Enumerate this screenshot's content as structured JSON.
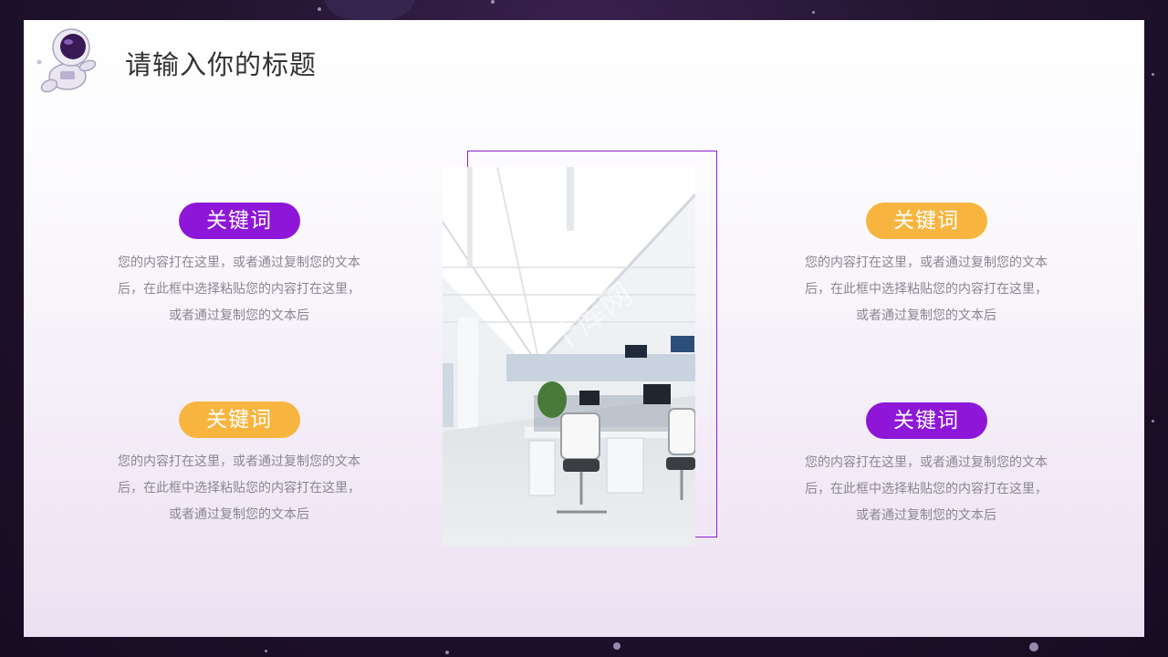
{
  "header": {
    "title": "请输入你的标题",
    "logo_icon": "astronaut-icon"
  },
  "image": {
    "icon": "office-photo-icon",
    "watermark": "千库网"
  },
  "items": [
    {
      "keyword": "关键词",
      "color": "#8e16d8",
      "description": [
        "您的内容打在这里，或者通过复制您的文本",
        "后，在此框中选择粘贴您的内容打在这里，",
        "或者通过复制您的文本后"
      ]
    },
    {
      "keyword": "关键词",
      "color": "#f7b53f",
      "description": [
        "您的内容打在这里，或者通过复制您的文本",
        "后，在此框中选择粘贴您的内容打在这里，",
        "或者通过复制您的文本后"
      ]
    },
    {
      "keyword": "关键词",
      "color": "#f7b53f",
      "description": [
        "您的内容打在这里，或者通过复制您的文本",
        "后，在此框中选择粘贴您的内容打在这里，",
        "或者通过复制您的文本后"
      ]
    },
    {
      "keyword": "关键词",
      "color": "#8e16d8",
      "description": [
        "您的内容打在这里，或者通过复制您的文本",
        "后，在此框中选择粘贴您的内容打在这里，",
        "或者通过复制您的文本后"
      ]
    }
  ],
  "colors": {
    "accent_purple": "#8e16d8",
    "accent_orange": "#f7b53f",
    "frame": "#8c1fc9"
  }
}
